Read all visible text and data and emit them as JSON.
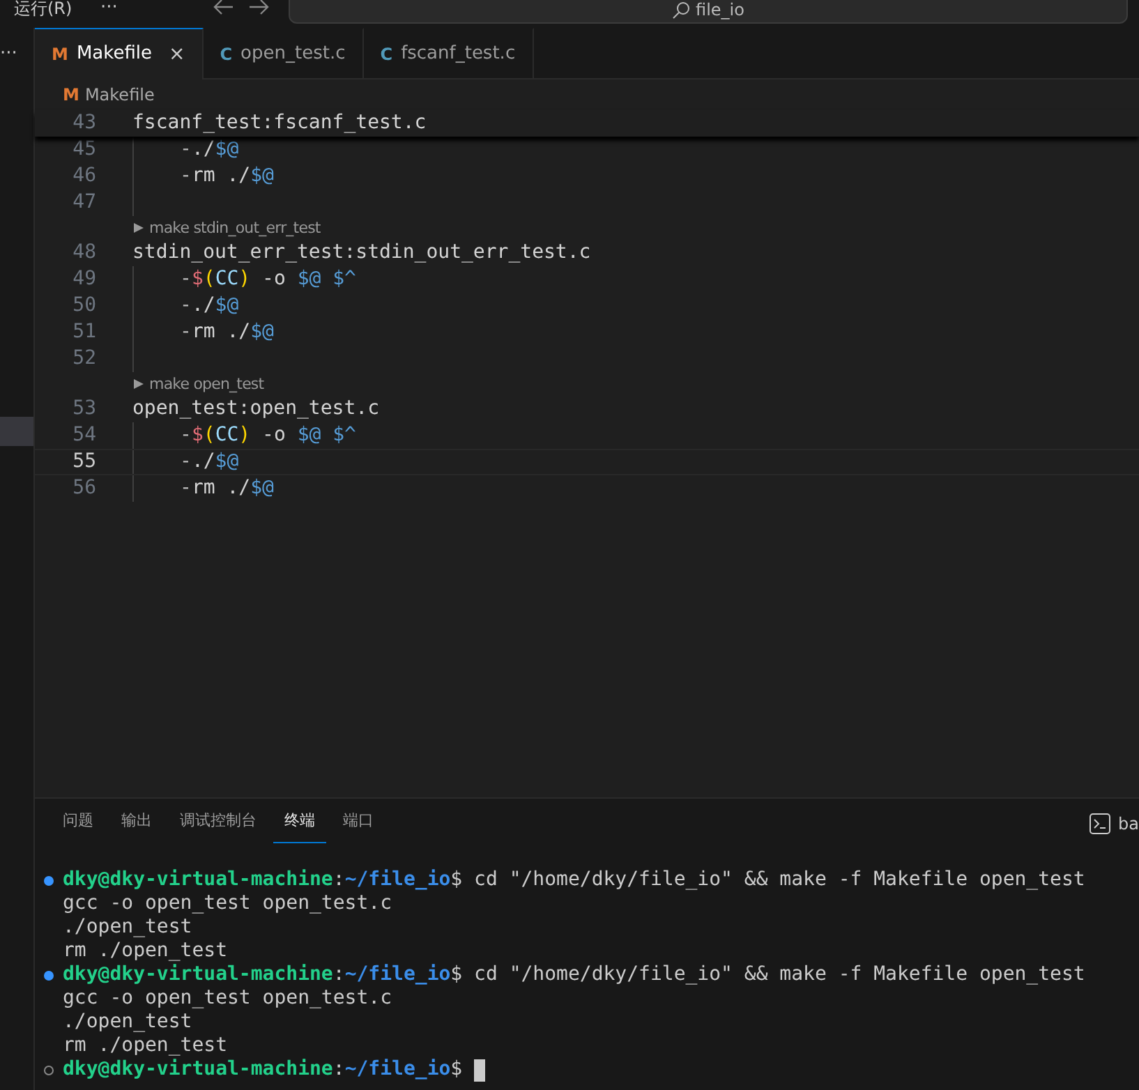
{
  "top_bar": {
    "menu": "运行(R)",
    "more": "···",
    "search": {
      "value": "file_io"
    }
  },
  "side_strip": {
    "more": "···",
    "highlight": true
  },
  "tabs": [
    {
      "label": "Makefile",
      "icon": "M",
      "kind": "makefile",
      "selected": true,
      "close": "×"
    },
    {
      "label": "open_test.c",
      "icon": "C",
      "kind": "c",
      "selected": false
    },
    {
      "label": "fscanf_test.c",
      "icon": "C",
      "kind": "c",
      "selected": false
    }
  ],
  "breadcrumb": {
    "icon": "M",
    "label": "Makefile"
  },
  "sticky_line": {
    "number": "43",
    "tokens": [
      {
        "kind": "plain",
        "text": "fscanf_test:fscanf_test.c"
      }
    ]
  },
  "lines": [
    {
      "kind": "recipe",
      "number": "45",
      "current": false,
      "tokens": [
        {
          "kind": "dash",
          "text": "-"
        },
        {
          "kind": "plain",
          "text": "./"
        },
        {
          "kind": "auto",
          "text": "$@"
        }
      ]
    },
    {
      "kind": "recipe",
      "number": "46",
      "current": false,
      "tokens": [
        {
          "kind": "dash",
          "text": "-"
        },
        {
          "kind": "plain",
          "text": "rm ./"
        },
        {
          "kind": "auto",
          "text": "$@"
        }
      ]
    },
    {
      "kind": "blank",
      "number": "47",
      "current": false
    },
    {
      "kind": "codelens",
      "text": "make stdin_out_err_test"
    },
    {
      "kind": "rule",
      "number": "48",
      "current": false,
      "tokens": [
        {
          "kind": "plain",
          "text": "stdin_out_err_test:stdin_out_err_test.c"
        }
      ]
    },
    {
      "kind": "recipe",
      "number": "49",
      "current": false,
      "tokens": [
        {
          "kind": "dash",
          "text": "-"
        },
        {
          "kind": "dollar",
          "text": "$"
        },
        {
          "kind": "paren",
          "text": "("
        },
        {
          "kind": "name",
          "text": "CC"
        },
        {
          "kind": "paren",
          "text": ")"
        },
        {
          "kind": "plain",
          "text": " -o "
        },
        {
          "kind": "auto",
          "text": "$@ $^"
        }
      ]
    },
    {
      "kind": "recipe",
      "number": "50",
      "current": false,
      "tokens": [
        {
          "kind": "dash",
          "text": "-"
        },
        {
          "kind": "plain",
          "text": "./"
        },
        {
          "kind": "auto",
          "text": "$@"
        }
      ]
    },
    {
      "kind": "recipe",
      "number": "51",
      "current": false,
      "tokens": [
        {
          "kind": "dash",
          "text": "-"
        },
        {
          "kind": "plain",
          "text": "rm ./"
        },
        {
          "kind": "auto",
          "text": "$@"
        }
      ]
    },
    {
      "kind": "blank",
      "number": "52",
      "current": false
    },
    {
      "kind": "codelens",
      "text": "make open_test"
    },
    {
      "kind": "rule",
      "number": "53",
      "current": false,
      "tokens": [
        {
          "kind": "plain",
          "text": "open_test:open_test.c"
        }
      ]
    },
    {
      "kind": "recipe",
      "number": "54",
      "current": false,
      "tokens": [
        {
          "kind": "dash",
          "text": "-"
        },
        {
          "kind": "dollar",
          "text": "$"
        },
        {
          "kind": "paren",
          "text": "("
        },
        {
          "kind": "name",
          "text": "CC"
        },
        {
          "kind": "paren",
          "text": ")"
        },
        {
          "kind": "plain",
          "text": " -o "
        },
        {
          "kind": "auto",
          "text": "$@ $^"
        }
      ]
    },
    {
      "kind": "recipe",
      "number": "55",
      "current": true,
      "tokens": [
        {
          "kind": "dash",
          "text": "-"
        },
        {
          "kind": "plain",
          "text": "./"
        },
        {
          "kind": "auto",
          "text": "$@"
        }
      ]
    },
    {
      "kind": "recipe",
      "number": "56",
      "current": false,
      "tokens": [
        {
          "kind": "dash",
          "text": "-"
        },
        {
          "kind": "plain",
          "text": "rm ./"
        },
        {
          "kind": "auto",
          "text": "$@"
        }
      ]
    }
  ],
  "panel_tabs": [
    {
      "label": "问题",
      "selected": false
    },
    {
      "label": "输出",
      "selected": false
    },
    {
      "label": "调试控制台",
      "selected": false
    },
    {
      "label": "终端",
      "selected": true
    },
    {
      "label": "端口",
      "selected": false
    }
  ],
  "terminal_switch": {
    "label": "ba"
  },
  "terminal": [
    {
      "kind": "prompt",
      "succeeded": true,
      "user": "dky@dky-virtual-machine",
      "separator": ":",
      "path": "~/file_io",
      "command": "$ cd \"/home/dky/file_io\" && make -f Makefile open_test",
      "cursor": false
    },
    {
      "kind": "output",
      "text": "gcc -o open_test open_test.c"
    },
    {
      "kind": "output",
      "text": "./open_test"
    },
    {
      "kind": "output",
      "text": "rm ./open_test"
    },
    {
      "kind": "prompt",
      "succeeded": true,
      "user": "dky@dky-virtual-machine",
      "separator": ":",
      "path": "~/file_io",
      "command": "$ cd \"/home/dky/file_io\" && make -f Makefile open_test",
      "cursor": false
    },
    {
      "kind": "output",
      "text": "gcc -o open_test open_test.c"
    },
    {
      "kind": "output",
      "text": "./open_test"
    },
    {
      "kind": "output",
      "text": "rm ./open_test"
    },
    {
      "kind": "prompt",
      "succeeded": false,
      "user": "dky@dky-virtual-machine",
      "separator": ":",
      "path": "~/file_io",
      "command": "$ ",
      "cursor": true
    }
  ]
}
